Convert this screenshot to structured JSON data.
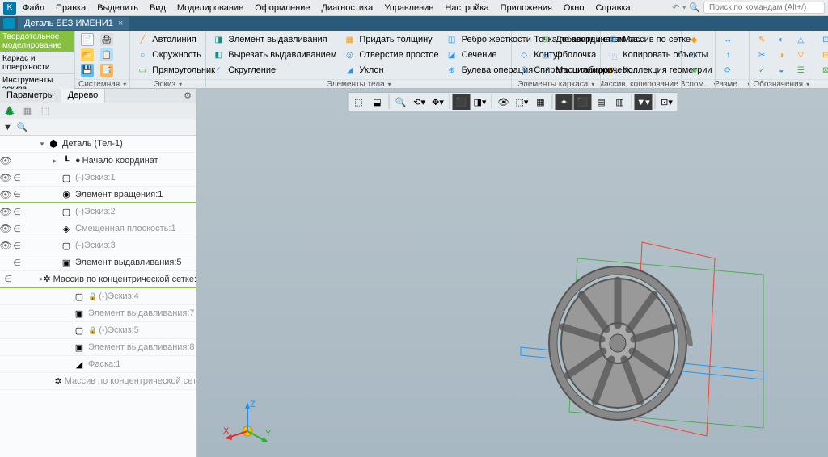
{
  "menu": {
    "items": [
      "Файл",
      "Правка",
      "Выделить",
      "Вид",
      "Моделирование",
      "Оформление",
      "Диагностика",
      "Управление",
      "Настройка",
      "Приложения",
      "Окно",
      "Справка"
    ],
    "search_placeholder": "Поиск по командам (Alt+/)"
  },
  "doc_tab": {
    "title": "Деталь БЕЗ ИМЕНИ1",
    "close": "×"
  },
  "vtabs": [
    "Твердотельное моделирование",
    "Каркас и поверхности",
    "Инструменты эскиза"
  ],
  "ribbon": {
    "groups": [
      {
        "caption": "Системная",
        "items": []
      },
      {
        "caption": "Эскиз",
        "items": [
          {
            "label": "Автолиния",
            "color": "#ff9800"
          },
          {
            "label": "Окружность",
            "color": "#2196f3"
          },
          {
            "label": "Прямоугольник",
            "color": "#4caf50"
          }
        ]
      },
      {
        "caption": "Элементы тела",
        "items": [
          {
            "label": "Элемент выдавливания",
            "color": "#009688"
          },
          {
            "label": "Вырезать выдавливанием",
            "color": "#009688"
          },
          {
            "label": "Скругление",
            "color": "#2196f3"
          },
          {
            "label": "Придать толщину",
            "color": "#ff9800"
          },
          {
            "label": "Отверстие простое",
            "color": "#2196f3"
          },
          {
            "label": "Уклон",
            "color": "#2196f3"
          },
          {
            "label": "Ребро жесткости",
            "color": "#2196f3"
          },
          {
            "label": "Сечение",
            "color": "#2196f3"
          },
          {
            "label": "Булева операция",
            "color": "#2196f3"
          },
          {
            "label": "Добавить деталь-за...",
            "color": "#4caf50"
          },
          {
            "label": "Оболочка",
            "color": "#2196f3"
          },
          {
            "label": "Масштабиров...",
            "color": "#2196f3"
          }
        ]
      },
      {
        "caption": "Элементы каркаса",
        "items": [
          {
            "label": "Точка по координатам",
            "color": "#ff9800"
          },
          {
            "label": "Контур",
            "color": "#2196f3"
          },
          {
            "label": "Спираль цилиндрическ...",
            "color": "#2196f3"
          }
        ]
      },
      {
        "caption": "Массив, копирование",
        "items": [
          {
            "label": "Массив по сетке",
            "color": "#2196f3"
          },
          {
            "label": "Копировать объекты",
            "color": "#2196f3"
          },
          {
            "label": "Коллекция геометрии",
            "color": "#ff9800"
          }
        ]
      },
      {
        "caption": "Вспом...",
        "items": []
      },
      {
        "caption": "Разме...",
        "items": []
      },
      {
        "caption": "Обозначения",
        "items": []
      }
    ]
  },
  "side": {
    "tabs": [
      "Параметры",
      "Дерево"
    ],
    "tree": [
      {
        "d": 0,
        "exp": "▾",
        "icon": "⬢",
        "label": "Деталь (Тел-1)",
        "vis": false,
        "inc": false
      },
      {
        "d": 1,
        "exp": "▸",
        "icon": "┗",
        "label": "Начало координат",
        "vis": true,
        "inc": false,
        "dot": true
      },
      {
        "d": 1,
        "exp": "",
        "icon": "▢",
        "label": "(-)Эскиз:1",
        "vis": true,
        "inc": true,
        "grey": true
      },
      {
        "d": 1,
        "exp": "",
        "icon": "◉",
        "label": "Элемент вращения:1",
        "vis": true,
        "inc": true,
        "hi": true
      },
      {
        "d": 1,
        "exp": "",
        "icon": "▢",
        "label": "(-)Эскиз:2",
        "vis": true,
        "inc": true,
        "grey": true
      },
      {
        "d": 1,
        "exp": "",
        "icon": "◈",
        "label": "Смещенная плоскость:1",
        "vis": true,
        "inc": true,
        "grey": true
      },
      {
        "d": 1,
        "exp": "",
        "icon": "▢",
        "label": "(-)Эскиз:3",
        "vis": true,
        "inc": true,
        "grey": true
      },
      {
        "d": 1,
        "exp": "",
        "icon": "▣",
        "label": "Элемент выдавливания:5",
        "vis": false,
        "inc": true
      },
      {
        "d": 1,
        "exp": "▸",
        "icon": "✲",
        "label": "Массив по концентрической сетке:",
        "vis": false,
        "inc": true,
        "hi": true
      },
      {
        "d": 2,
        "exp": "",
        "icon": "▢",
        "label": "(-)Эскиз:4",
        "grey": true,
        "lock": true
      },
      {
        "d": 2,
        "exp": "",
        "icon": "▣",
        "label": "Элемент выдавливания:7",
        "grey": true
      },
      {
        "d": 2,
        "exp": "",
        "icon": "▢",
        "label": "(-)Эскиз:5",
        "grey": true,
        "lock": true
      },
      {
        "d": 2,
        "exp": "",
        "icon": "▣",
        "label": "Элемент выдавливания:8",
        "grey": true
      },
      {
        "d": 2,
        "exp": "",
        "icon": "◢",
        "label": "Фаска:1",
        "grey": true
      },
      {
        "d": 2,
        "exp": "",
        "icon": "✲",
        "label": "Массив по концентрической сет",
        "grey": true
      }
    ]
  },
  "axis": {
    "x": "X",
    "y": "Y",
    "z": "Z"
  }
}
